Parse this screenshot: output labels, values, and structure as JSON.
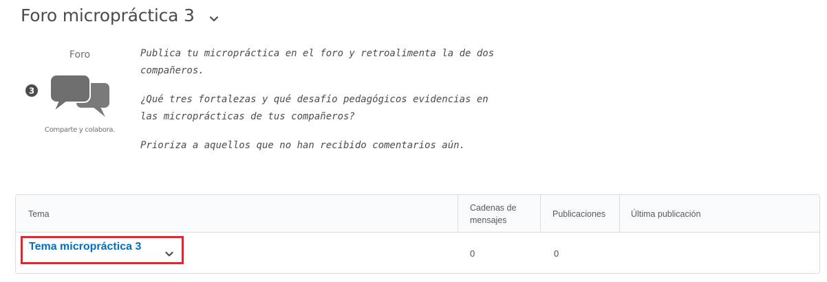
{
  "header": {
    "title": "Foro micropráctica 3",
    "chevron_icon": "chevron-down-icon"
  },
  "badge": {
    "label": "Foro",
    "number": "3",
    "icon": "chat-bubbles-icon",
    "caption": "Comparte y colabora."
  },
  "description": {
    "paragraphs": [
      "Publica tu micropráctica en el foro y retroalimenta la de dos compañeros.",
      "¿Qué tres fortalezas y qué desafío pedagógicos evidencias en las microprácticas de tus compañeros?",
      "Prioriza a aquellos que no han recibido comentarios aún."
    ]
  },
  "table": {
    "headers": {
      "topic": "Tema",
      "threads": "Cadenas de mensajes",
      "posts": "Publicaciones",
      "last_post": "Última publicación"
    },
    "rows": [
      {
        "topic": "Tema micropráctica 3",
        "threads": "0",
        "posts": "0",
        "last_post": ""
      }
    ]
  },
  "colors": {
    "link": "#006fbf",
    "highlight": "#d12d36",
    "text": "#494c4e",
    "border": "#dadbdd"
  }
}
